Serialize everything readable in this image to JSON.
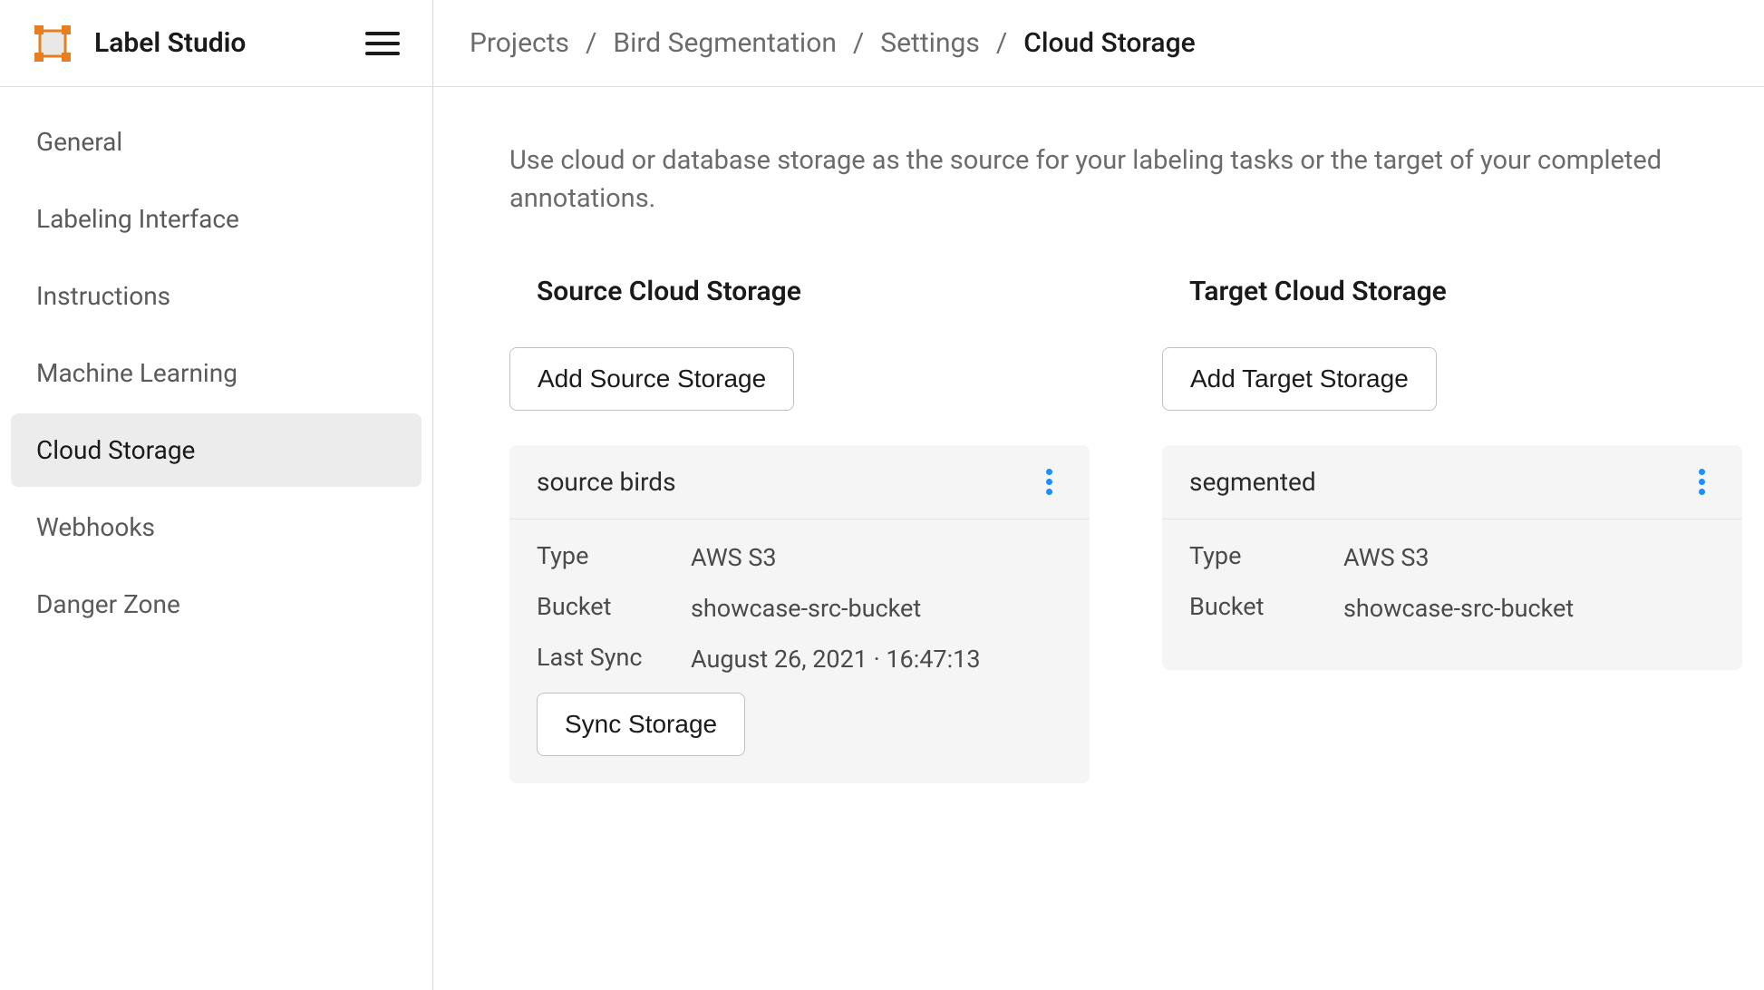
{
  "brand": "Label Studio",
  "sidebar": {
    "items": [
      {
        "label": "General",
        "active": false
      },
      {
        "label": "Labeling Interface",
        "active": false
      },
      {
        "label": "Instructions",
        "active": false
      },
      {
        "label": "Machine Learning",
        "active": false
      },
      {
        "label": "Cloud Storage",
        "active": true
      },
      {
        "label": "Webhooks",
        "active": false
      },
      {
        "label": "Danger Zone",
        "active": false
      }
    ]
  },
  "breadcrumbs": [
    {
      "label": "Projects",
      "current": false
    },
    {
      "label": "Bird Segmentation",
      "current": false
    },
    {
      "label": "Settings",
      "current": false
    },
    {
      "label": "Cloud Storage",
      "current": true
    }
  ],
  "description": "Use cloud or database storage as the source for your labeling tasks or the target of your completed annotations.",
  "source": {
    "heading": "Source Cloud Storage",
    "add_label": "Add Source Storage",
    "card": {
      "title": "source birds",
      "type_label": "Type",
      "type_value": "AWS S3",
      "bucket_label": "Bucket",
      "bucket_value": "showcase-src-bucket",
      "lastsync_label": "Last Sync",
      "lastsync_value": "August 26, 2021 · 16:47:13",
      "sync_label": "Sync Storage"
    }
  },
  "target": {
    "heading": "Target Cloud Storage",
    "add_label": "Add Target Storage",
    "card": {
      "title": "segmented",
      "type_label": "Type",
      "type_value": "AWS S3",
      "bucket_label": "Bucket",
      "bucket_value": "showcase-src-bucket"
    }
  }
}
